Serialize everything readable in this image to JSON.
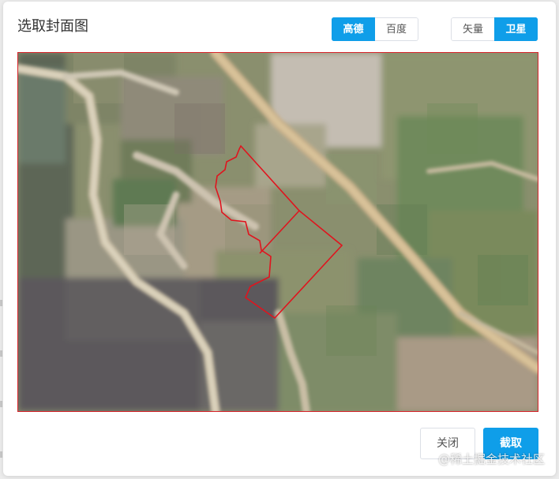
{
  "dialog": {
    "title": "选取封面图"
  },
  "map_source": {
    "options": [
      "高德",
      "百度"
    ],
    "selected": "高德"
  },
  "map_type": {
    "options": [
      "矢量",
      "卫星"
    ],
    "selected": "卫星"
  },
  "footer": {
    "close_label": "关闭",
    "crop_label": "截取"
  },
  "watermark": "@稀土掘金技术社区",
  "colors": {
    "accent": "#0f9ee9",
    "boundary": "#e0141e"
  }
}
